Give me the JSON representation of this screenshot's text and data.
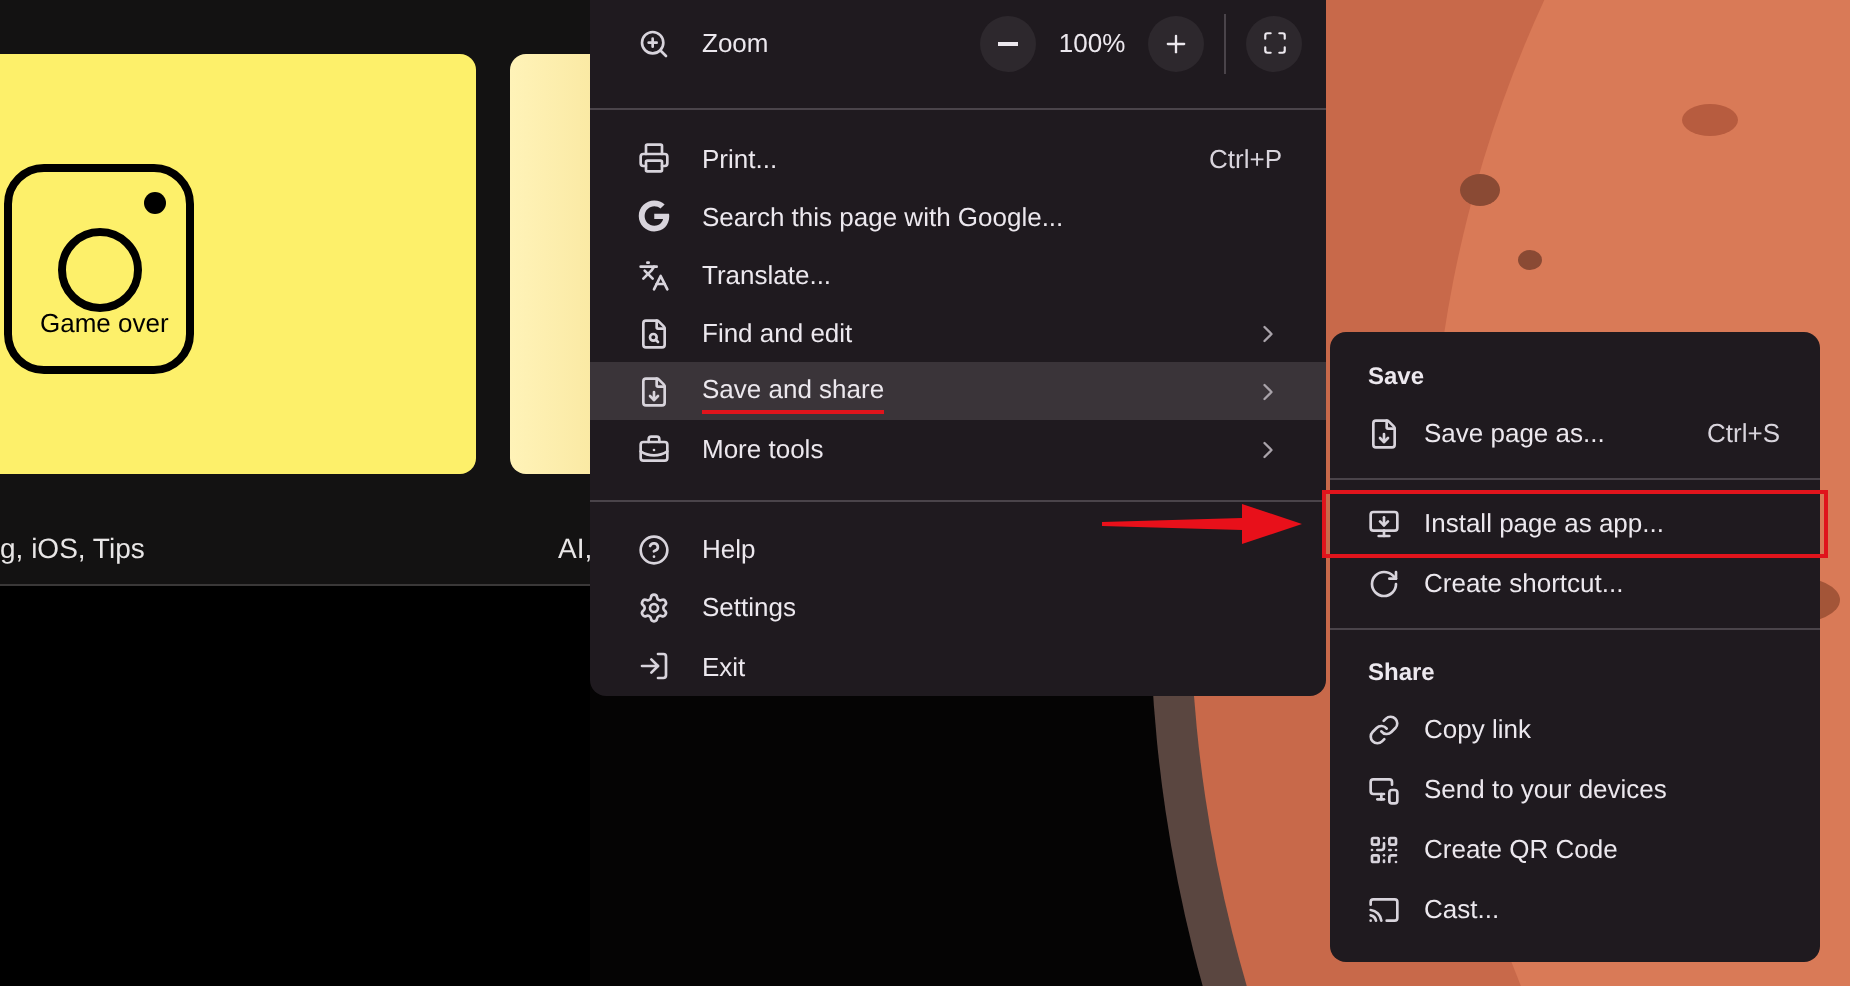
{
  "page": {
    "cards": [
      {
        "artwork_text": "Game over",
        "caption": "g, iOS, Tips"
      },
      {
        "caption": "AI,"
      }
    ]
  },
  "menu": {
    "zoom": {
      "label": "Zoom",
      "value": "100%"
    },
    "items": [
      {
        "kind": "divider"
      },
      {
        "kind": "item",
        "label": "Print...",
        "shortcut": "Ctrl+P",
        "selected": false,
        "underlined": false,
        "has_submenu": false
      },
      {
        "kind": "item",
        "label": "Search this page with Google...",
        "selected": false,
        "underlined": false,
        "has_submenu": false
      },
      {
        "kind": "item",
        "label": "Translate...",
        "selected": false,
        "underlined": false,
        "has_submenu": false
      },
      {
        "kind": "item",
        "label": "Find and edit",
        "selected": false,
        "underlined": false,
        "has_submenu": true
      },
      {
        "kind": "item",
        "label": "Save and share",
        "selected": true,
        "underlined": true,
        "has_submenu": true
      },
      {
        "kind": "item",
        "label": "More tools",
        "selected": false,
        "underlined": false,
        "has_submenu": true
      },
      {
        "kind": "divider"
      },
      {
        "kind": "item",
        "label": "Help",
        "selected": false,
        "underlined": false,
        "has_submenu": false
      },
      {
        "kind": "item",
        "label": "Settings",
        "selected": false,
        "underlined": false,
        "has_submenu": false
      },
      {
        "kind": "item",
        "label": "Exit",
        "selected": false,
        "underlined": false,
        "has_submenu": false
      }
    ]
  },
  "submenu": {
    "items": [
      {
        "kind": "header",
        "label": "Save"
      },
      {
        "kind": "item",
        "label": "Save page as...",
        "shortcut": "Ctrl+S",
        "highlighted": false
      },
      {
        "kind": "divider"
      },
      {
        "kind": "item",
        "label": "Install page as app...",
        "highlighted": true
      },
      {
        "kind": "item",
        "label": "Create shortcut...",
        "highlighted": false
      },
      {
        "kind": "divider"
      },
      {
        "kind": "header",
        "label": "Share"
      },
      {
        "kind": "item",
        "label": "Copy link",
        "highlighted": false
      },
      {
        "kind": "item",
        "label": "Send to your devices",
        "highlighted": false
      },
      {
        "kind": "item",
        "label": "Create QR Code",
        "highlighted": false
      },
      {
        "kind": "item",
        "label": "Cast...",
        "highlighted": false
      }
    ]
  }
}
